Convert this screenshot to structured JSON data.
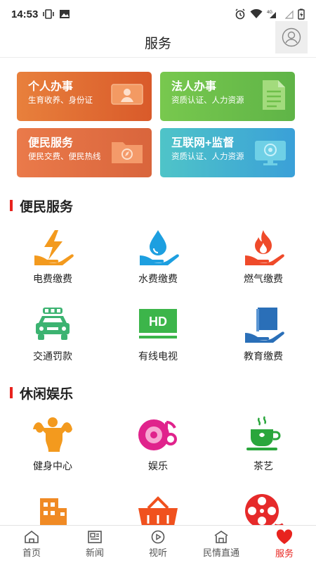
{
  "status": {
    "time": "14:53",
    "network": "4G"
  },
  "header": {
    "title": "服务"
  },
  "cards": [
    {
      "title": "个人办事",
      "sub": "生育收养、身份证",
      "color": "#e06a30"
    },
    {
      "title": "法人办事",
      "sub": "资质认证、人力资源",
      "color": "#6cbe4b"
    },
    {
      "title": "便民服务",
      "sub": "便民交费、便民热线",
      "color": "#e2703f"
    },
    {
      "title": "互联网+监督",
      "sub": "资质认证、人力资源",
      "color": "#45b2d0"
    }
  ],
  "sections": {
    "convenience": {
      "title": "便民服务",
      "items": [
        "电费缴费",
        "水费缴费",
        "燃气缴费",
        "交通罚款",
        "有线电视",
        "教育缴费"
      ]
    },
    "leisure": {
      "title": "休闲娱乐",
      "items": [
        "健身中心",
        "娱乐",
        "茶艺"
      ]
    }
  },
  "tabs": [
    "首页",
    "新闻",
    "视听",
    "民情直通",
    "服务"
  ],
  "active_tab": "服务",
  "hd_text": "HD",
  "accent": "#e8231e"
}
